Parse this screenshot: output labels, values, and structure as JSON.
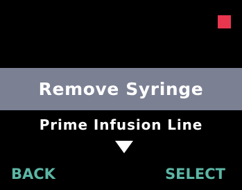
{
  "colors": {
    "background": "#000000",
    "highlight_bar": "#7b8093",
    "text": "#ffffff",
    "softkey": "#5cb6a5",
    "status_indicator": "#e8364f",
    "arrow": "#ffffff"
  },
  "status": {
    "indicator_icon": "status-square-icon"
  },
  "menu": {
    "selected_item": "Remove Syringe",
    "next_item": "Prime Infusion Line",
    "scroll_icon": "triangle-down-icon"
  },
  "softkeys": {
    "left_label": "BACK",
    "right_label": "SELECT"
  }
}
